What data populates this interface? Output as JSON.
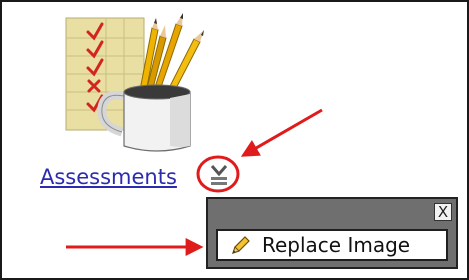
{
  "item": {
    "link_label": "Assessments",
    "image_icon": "assessment-clipart-icon",
    "menu_icon": "chevron-down-icon"
  },
  "popup": {
    "close_label": "X",
    "replace_label": "Replace Image",
    "replace_icon": "pencil-icon"
  },
  "colors": {
    "link": "#2b2bb0",
    "annotation": "#e01b1b",
    "popup_bg": "#6f6f6f"
  }
}
